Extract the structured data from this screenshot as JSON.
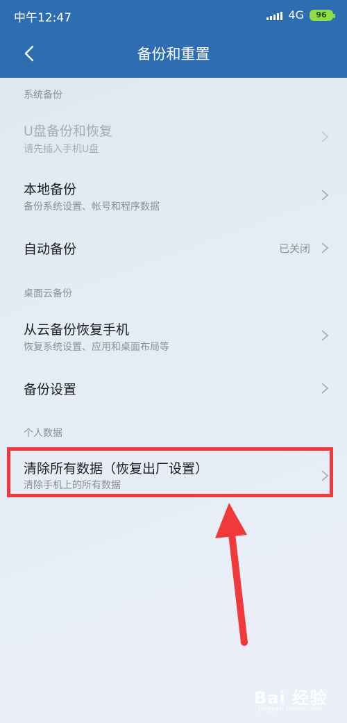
{
  "status": {
    "time": "中午12:47",
    "network": "4G",
    "battery": "96"
  },
  "header": {
    "title": "备份和重置"
  },
  "sections": {
    "system_backup": "系统备份",
    "cloud_backup": "桌面云备份",
    "personal_data": "个人数据"
  },
  "rows": {
    "usb": {
      "title": "U盘备份和恢复",
      "subtitle": "请先插入手机U盘"
    },
    "local": {
      "title": "本地备份",
      "subtitle": "备份系统设置、帐号和程序数据"
    },
    "auto": {
      "title": "自动备份",
      "value": "已关闭"
    },
    "cloud_restore": {
      "title": "从云备份恢复手机",
      "subtitle": "恢复系统设置、应用和桌面布局等"
    },
    "backup_settings": {
      "title": "备份设置"
    },
    "factory_reset": {
      "title": "清除所有数据（恢复出厂设置）",
      "subtitle": "清除手机上的所有数据"
    }
  },
  "watermark": {
    "text": "Bai 经验",
    "sub": "jingyan.baidu.com"
  },
  "colors": {
    "header": "#2f6db3",
    "highlight": "#f0393b",
    "battery": "#8fdc4a"
  }
}
